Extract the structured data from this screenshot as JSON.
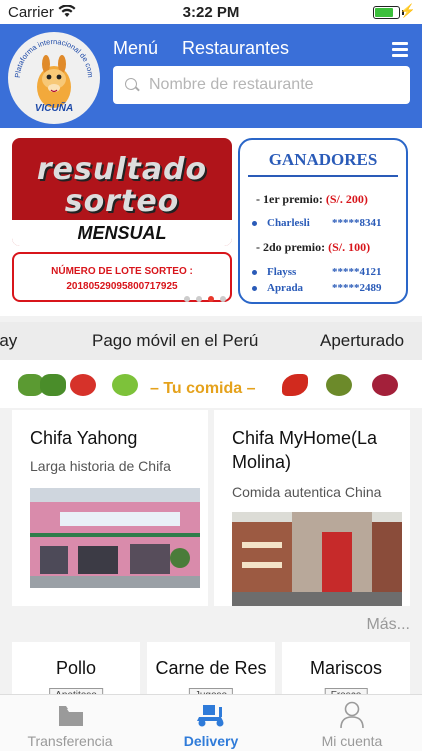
{
  "status_bar": {
    "carrier": "Carrier",
    "time": "3:22 PM"
  },
  "header": {
    "logo_arc_text": "Plataforma internacional de comida",
    "logo_name": "VICUÑA",
    "nav_menu": "Menú",
    "nav_restaurantes": "Restaurantes",
    "search_placeholder": "Nombre de restaurante"
  },
  "banner": {
    "resultado_line1": "resultado",
    "resultado_line2": "sorteo",
    "mensual": "MENSUAL",
    "lote_label": "NÚMERO DE LOTE SORTEO :",
    "lote_number": "2018052909580071792​5",
    "ganadores_title": "GANADORES",
    "prize1_label": "- 1er premio:",
    "prize1_amount": "(S/. 200)",
    "prize1_winner": "Charlesli",
    "prize1_code": "*****8341",
    "prize2_label": "- 2do premio:",
    "prize2_amount": "(S/. 100)",
    "prize2_winner1": "Flayss",
    "prize2_code1": "*****4121",
    "prize2_winner2": "Aprada",
    "prize2_code2": "*****2489",
    "carousel_total": 4,
    "carousel_active": 3
  },
  "ticker": [
    "Pay",
    "Pago móvil en el Perú",
    "Aperturado"
  ],
  "tu_comida": "– Tu comida –",
  "restaurants": [
    {
      "name": "Chifa Yahong",
      "description": "Larga historia de Chifa"
    },
    {
      "name": "Chifa MyHome(La Molina)",
      "description": "Comida autentica China"
    }
  ],
  "mas": "Más...",
  "categories": [
    {
      "name": "Pollo",
      "tag": "Apetitoso"
    },
    {
      "name": "Carne de Res",
      "tag": "Jugoso"
    },
    {
      "name": "Mariscos",
      "tag": "Fresco"
    }
  ],
  "tabs": [
    {
      "label": "Transferencia",
      "icon": "folder-icon"
    },
    {
      "label": "Delivery",
      "icon": "scooter-icon"
    },
    {
      "label": "Mi cuenta",
      "icon": "person-icon"
    }
  ],
  "colors": {
    "header_blue": "#3a6fd8",
    "accent_red": "#d8151b",
    "tab_active": "#2f7bd9",
    "gold": "#e5a21c"
  }
}
